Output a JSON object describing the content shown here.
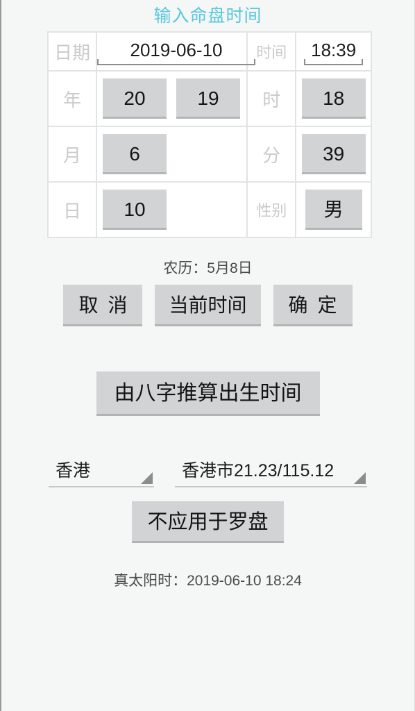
{
  "header": {
    "title": "输入命盘时间",
    "title_color": "#56c8de"
  },
  "grid": {
    "row_date": {
      "date_label": "日期",
      "date_value": "2019-06-10",
      "time_label": "时间",
      "time_value": "18:39"
    },
    "row_year": {
      "label": "年",
      "value_hi": "20",
      "value_lo": "19",
      "right_label": "时",
      "right_value": "18"
    },
    "row_month": {
      "label": "月",
      "value": "6",
      "right_label": "分",
      "right_value": "39"
    },
    "row_day": {
      "label": "日",
      "value": "10",
      "right_label": "性别",
      "right_value": "男"
    }
  },
  "lunar": {
    "text": "农历：5月8日"
  },
  "actions": {
    "cancel_label": "取消",
    "now_label": "当前时间",
    "confirm_label": "确定"
  },
  "bazi": {
    "label": "由八字推算出生时间"
  },
  "location": {
    "region": "香港",
    "city": "香港市21.23/115.12"
  },
  "compass": {
    "label": "不应用于罗盘"
  },
  "solar": {
    "text": "真太阳时：2019-06-10  18:24"
  },
  "colors": {
    "background": "#f5f6f6",
    "button_face": "#d2d3d4",
    "button_shadow": "#b2b3b4",
    "label_grey": "#c9cacb",
    "text_dark": "#141414"
  }
}
